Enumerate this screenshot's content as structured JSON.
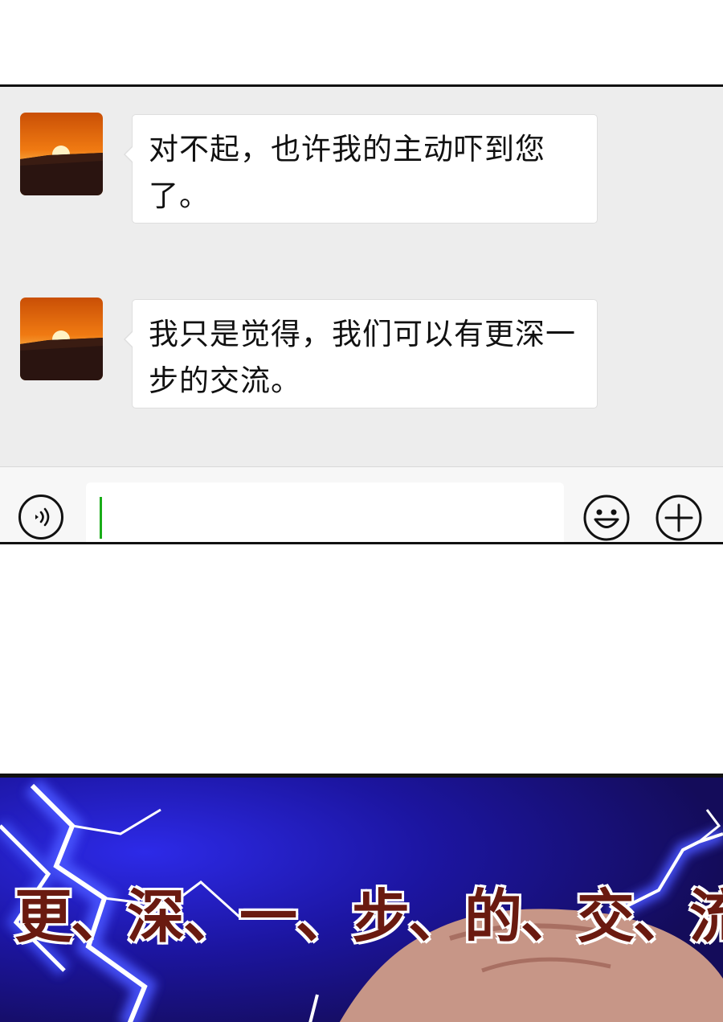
{
  "chat": {
    "messages": [
      {
        "sender": "other",
        "avatar": "sunset-avatar",
        "text": "对不起，也许我的主动吓到您了。"
      },
      {
        "sender": "other",
        "avatar": "sunset-avatar",
        "text": "我只是觉得，我们可以有更深一步的交流。"
      }
    ],
    "input": {
      "value": "",
      "placeholder": ""
    },
    "icons": {
      "voice": "voice-icon",
      "emoji": "smiley-icon",
      "plus": "plus-icon"
    }
  },
  "comic": {
    "shout_text": "更、深、一、步、的、交、流。"
  },
  "colors": {
    "chat_bg": "#ededed",
    "bubble_bg": "#ffffff",
    "caret": "#1aad19",
    "comic_bg": "#1a0f6e",
    "shout_fill": "#6a1a10"
  }
}
